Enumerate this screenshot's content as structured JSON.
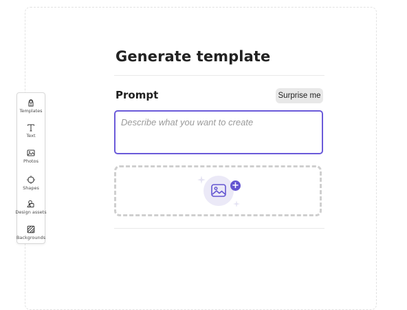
{
  "rail": {
    "items": [
      {
        "label": "Templates",
        "icon": "templates-icon"
      },
      {
        "label": "Text",
        "icon": "text-icon"
      },
      {
        "label": "Photos",
        "icon": "photos-icon"
      },
      {
        "label": "Shapes",
        "icon": "shapes-icon"
      },
      {
        "label": "Design assets",
        "icon": "design-assets-icon"
      },
      {
        "label": "Backgrounds",
        "icon": "backgrounds-icon"
      }
    ]
  },
  "panel": {
    "title": "Generate template",
    "prompt_label": "Prompt",
    "surprise_label": "Surprise me",
    "prompt_value": "",
    "prompt_placeholder": "Describe what you want to create",
    "upload_icon": "add-image-icon"
  },
  "colors": {
    "accent": "#6a5ad9",
    "badge": "#6456d1",
    "drop_circle": "#ebe9f7",
    "dash": "#cfcfcf"
  }
}
